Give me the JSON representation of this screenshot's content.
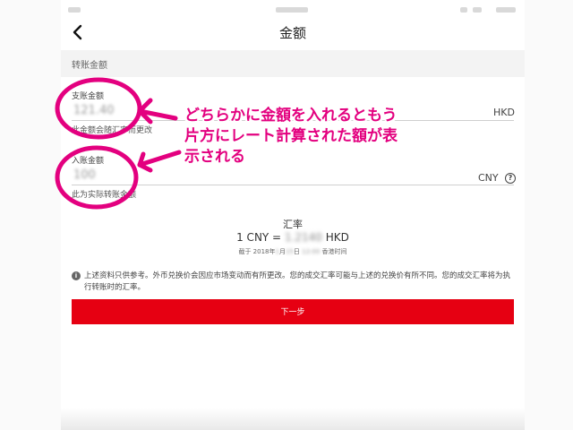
{
  "header": {
    "title": "金额"
  },
  "section": {
    "title": "转账金额"
  },
  "debit": {
    "label": "支账金额",
    "value": "121.40",
    "currency": "HKD",
    "hint": "此金额会随汇率而更改"
  },
  "credit": {
    "label": "入账金额",
    "value": "100",
    "currency": "CNY",
    "hint": "此为实际转账金额",
    "help_icon_glyph": "?"
  },
  "exchange": {
    "title": "汇率",
    "prefix": "1 CNY = ",
    "rate": "1.2140",
    "suffix": " HKD",
    "time_prefix": "截于 2018年",
    "time_month": " 1 ",
    "time_mid": "月",
    "time_day": " 15 ",
    "time_day_unit": "日 ",
    "time_clock": "12:00",
    "time_suffix": " 香港时间"
  },
  "disclaimer": {
    "icon_glyph": "i",
    "text": "上述资料只供参考。外币兑换价会因应市场变动而有所更改。您的成交汇率可能与上述的兑换价有所不同。您的成交汇率将为执行转账时的汇率。"
  },
  "actions": {
    "next_label": "下一步"
  },
  "annotation": {
    "line1": "どちらかに金額を入れるともう",
    "line2": "片方にレート計算された額が表",
    "line3": "示される"
  },
  "colors": {
    "accent": "#e60012",
    "annotation": "#e3007f"
  }
}
